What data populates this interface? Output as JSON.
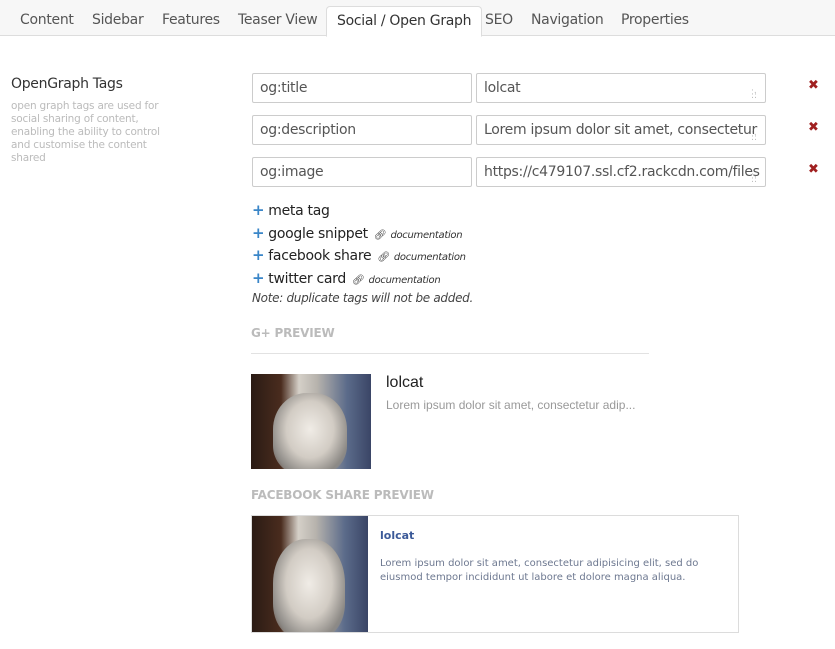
{
  "tabs": [
    {
      "label": "Content",
      "active": false
    },
    {
      "label": "Sidebar",
      "active": false
    },
    {
      "label": "Features",
      "active": false
    },
    {
      "label": "Teaser View",
      "active": false
    },
    {
      "label": "Social / Open Graph",
      "active": true
    },
    {
      "label": "SEO",
      "active": false
    },
    {
      "label": "Navigation",
      "active": false
    },
    {
      "label": "Properties",
      "active": false
    }
  ],
  "section": {
    "title": "OpenGraph Tags",
    "description": "open graph tags are used for social sharing of content, enabling the ability to control and customise the content shared"
  },
  "tags": [
    {
      "key": "og:title",
      "value": "lolcat"
    },
    {
      "key": "og:description",
      "value": "Lorem ipsum dolor sit amet, consectetur"
    },
    {
      "key": "og:image",
      "value": "https://c479107.ssl.cf2.rackcdn.com/files"
    }
  ],
  "icons": {
    "remove": "✖",
    "plus": "+",
    "link": "🔗",
    "grip": "resize-grip-icon"
  },
  "add_actions": [
    {
      "label": "meta tag",
      "doc": null
    },
    {
      "label": "google snippet",
      "doc": "documentation"
    },
    {
      "label": "facebook share",
      "doc": "documentation"
    },
    {
      "label": "twitter card",
      "doc": "documentation"
    }
  ],
  "note": "Note: duplicate tags will not be added.",
  "gplus_preview": {
    "heading": "G+ PREVIEW",
    "title": "lolcat",
    "description": "Lorem ipsum dolor sit amet, consectetur adip..."
  },
  "facebook_preview": {
    "heading": "FACEBOOK SHARE PREVIEW",
    "title": "lolcat",
    "description": "Lorem ipsum dolor sit amet, consectetur adipisicing elit, sed do eiusmod tempor incididunt ut labore et dolore magna aliqua."
  },
  "colors": {
    "remove": "#a02020",
    "plus": "#3a86c8",
    "facebook_title": "#3b5998"
  }
}
